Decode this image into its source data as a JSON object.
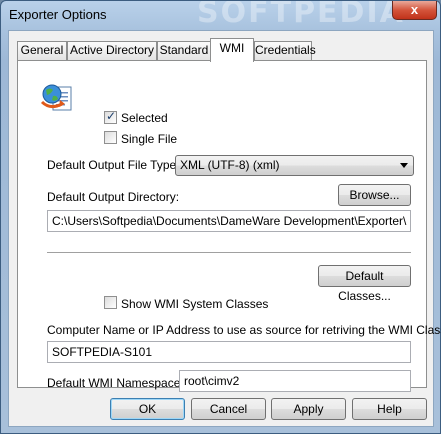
{
  "window": {
    "title": "Exporter Options",
    "watermark": "SOFTPEDIA",
    "close_label": "x"
  },
  "tabs": [
    {
      "label": "General",
      "active": false
    },
    {
      "label": "Active Directory",
      "active": false
    },
    {
      "label": "Standard",
      "active": false
    },
    {
      "label": "WMI",
      "active": true
    },
    {
      "label": "Credentials",
      "active": false
    }
  ],
  "wmi": {
    "selected_label": "Selected",
    "selected_checked": true,
    "single_file_label": "Single File",
    "single_file_checked": false,
    "output_type_label": "Default Output File Type:",
    "output_type_value": "XML (UTF-8) (xml)",
    "output_dir_label": "Default Output Directory:",
    "browse_label": "Browse...",
    "output_dir_value": "C:\\Users\\Softpedia\\Documents\\DameWare Development\\Exporter\\",
    "default_classes_label": "Default Classes...",
    "show_system_label": "Show WMI System Classes",
    "show_system_checked": false,
    "computer_label": "Computer Name or IP Address to use as source for retriving the WMI Classes:",
    "computer_value": "SOFTPEDIA-S101",
    "namespace_label": "Default WMI Namespace:",
    "namespace_value": "root\\cimv2"
  },
  "footer": {
    "ok_label": "OK",
    "cancel_label": "Cancel",
    "apply_label": "Apply",
    "help_label": "Help"
  },
  "icons": {
    "exporter": "exporter-globe-document-icon",
    "check": "checkmark-icon",
    "dropdown": "chevron-down-icon"
  }
}
